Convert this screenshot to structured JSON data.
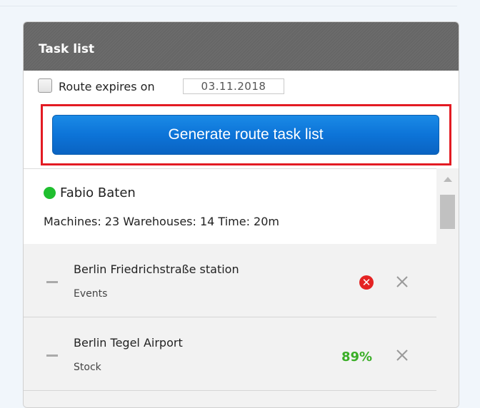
{
  "panel": {
    "title": "Task list"
  },
  "controls": {
    "route_expires_label": "Route expires on",
    "route_expires_checked": false,
    "date_value": "03.11.2018",
    "generate_button_label": "Generate route task list"
  },
  "driver": {
    "name": "Fabio Baten",
    "status_color": "#1fbf2f",
    "stats": "Machines: 23 Warehouses: 14 Time: 20m"
  },
  "tasks": [
    {
      "title": "Berlin Friedrichstraße station",
      "subtitle": "Events",
      "status_icon": "error-icon",
      "status_text": "✕"
    },
    {
      "title": "Berlin Tegel Airport",
      "subtitle": "Stock",
      "status_text": "89%"
    }
  ],
  "colors": {
    "accent_blue": "#0d74d8",
    "highlight_red": "#e31b23",
    "success_green": "#3aae27",
    "error_red": "#e42323"
  }
}
